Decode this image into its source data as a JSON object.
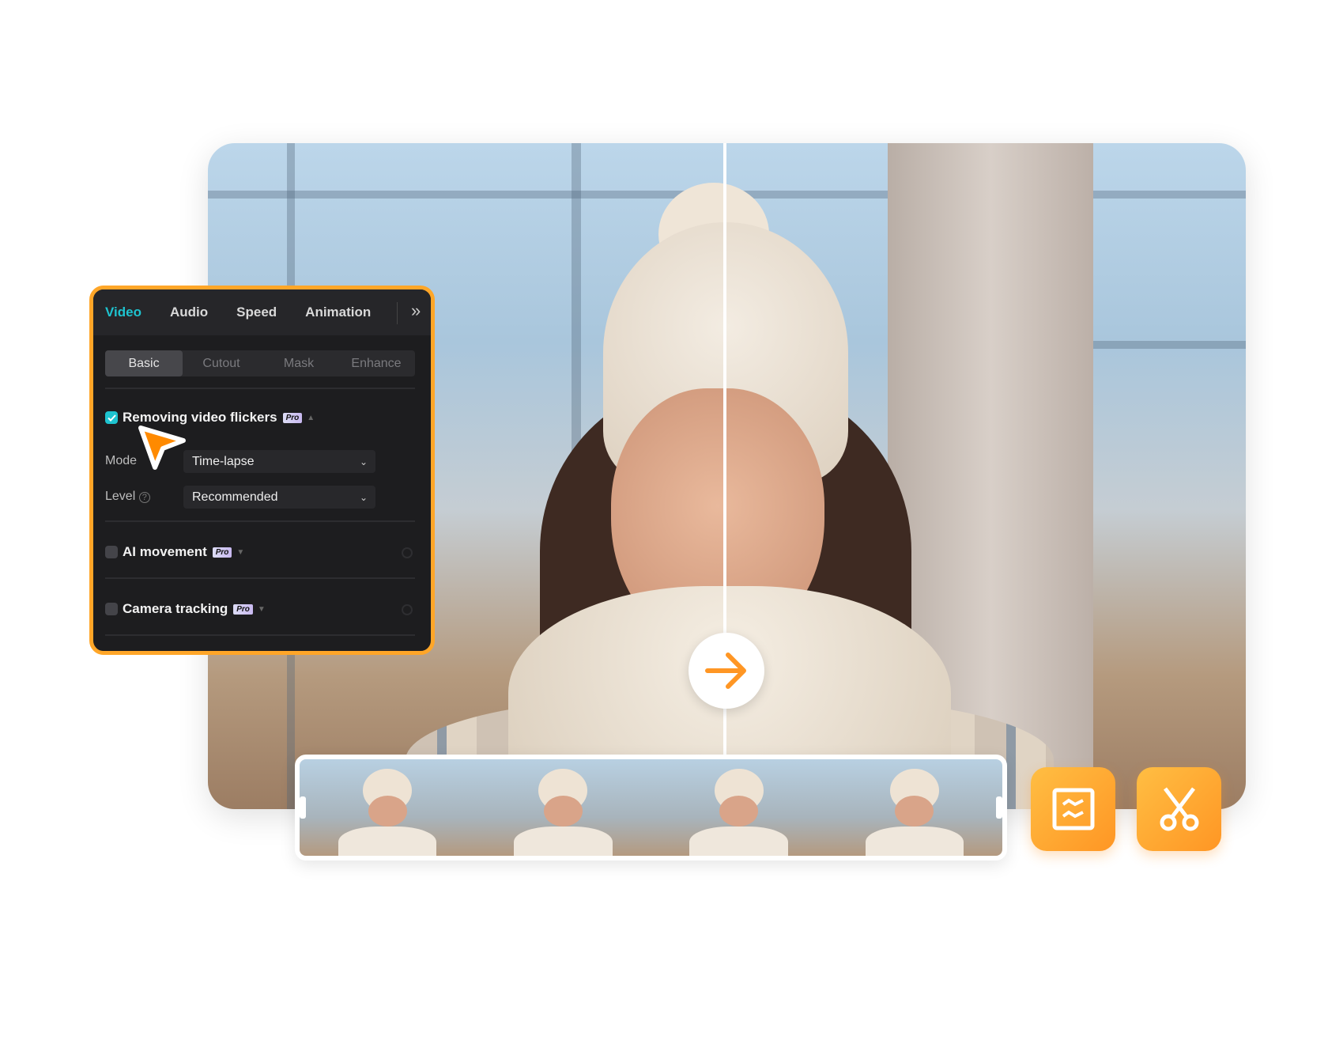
{
  "panel": {
    "tabs": [
      {
        "label": "Video",
        "active": true
      },
      {
        "label": "Audio"
      },
      {
        "label": "Speed"
      },
      {
        "label": "Animation"
      }
    ],
    "more_icon": "chevrons-right-icon",
    "subtabs": [
      {
        "label": "Basic",
        "active": true
      },
      {
        "label": "Cutout"
      },
      {
        "label": "Mask"
      },
      {
        "label": "Enhance"
      }
    ],
    "flicker": {
      "label": "Removing video flickers",
      "badge": "Pro",
      "checked": true
    },
    "mode": {
      "label": "Mode",
      "value": "Time-lapse"
    },
    "level": {
      "label": "Level",
      "value": "Recommended"
    },
    "ai_movement": {
      "label": "AI movement",
      "badge": "Pro",
      "checked": false
    },
    "camera_tracking": {
      "label": "Camera tracking",
      "badge": "Pro",
      "checked": false
    }
  },
  "colors": {
    "accent": "#1ec3cf",
    "brand_orange": "#ff9624"
  },
  "tools": [
    "deflicker-icon",
    "scissors-icon"
  ]
}
